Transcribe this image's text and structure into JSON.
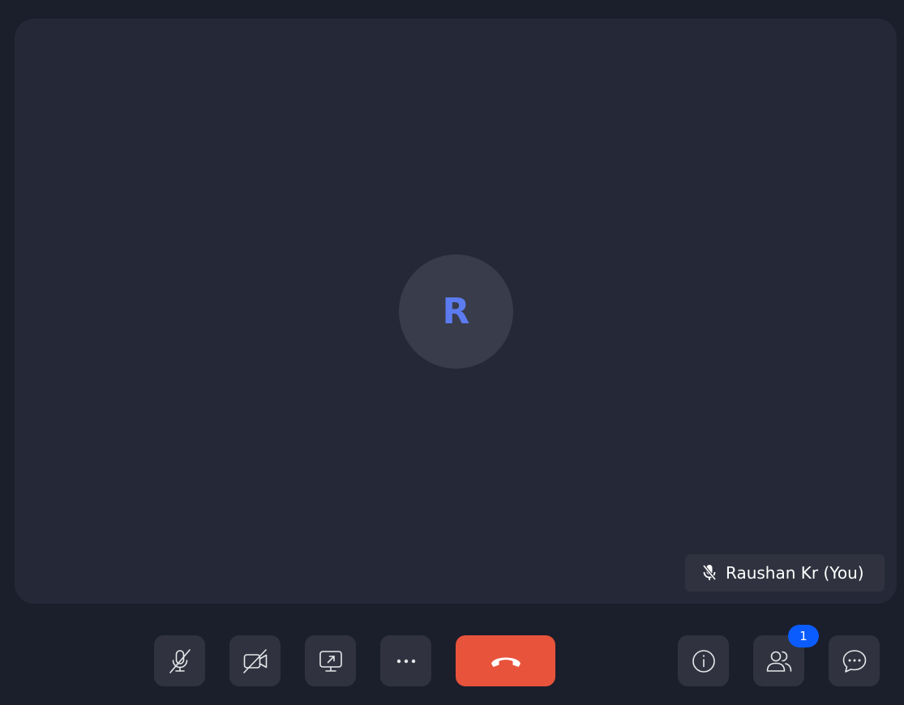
{
  "participant": {
    "initial": "R",
    "name_label": "Raushan Kr (You)",
    "mic_state_icon": "mic-muted-icon"
  },
  "controls": {
    "mic": {
      "icon": "mic-off-icon"
    },
    "camera": {
      "icon": "video-off-icon"
    },
    "share": {
      "icon": "screen-share-icon"
    },
    "more": {
      "icon": "more-dots-icon"
    },
    "end_call": {
      "icon": "phone-hangup-icon"
    },
    "info": {
      "icon": "info-icon"
    },
    "participants": {
      "icon": "participants-icon",
      "count": "1"
    },
    "chat": {
      "icon": "chat-icon"
    }
  },
  "colors": {
    "background": "#1b1e2b",
    "stage": "#252836",
    "control": "#30333f",
    "avatar_letter": "#5b7bef",
    "end_call": "#e8533c",
    "badge": "#0b5cff"
  }
}
